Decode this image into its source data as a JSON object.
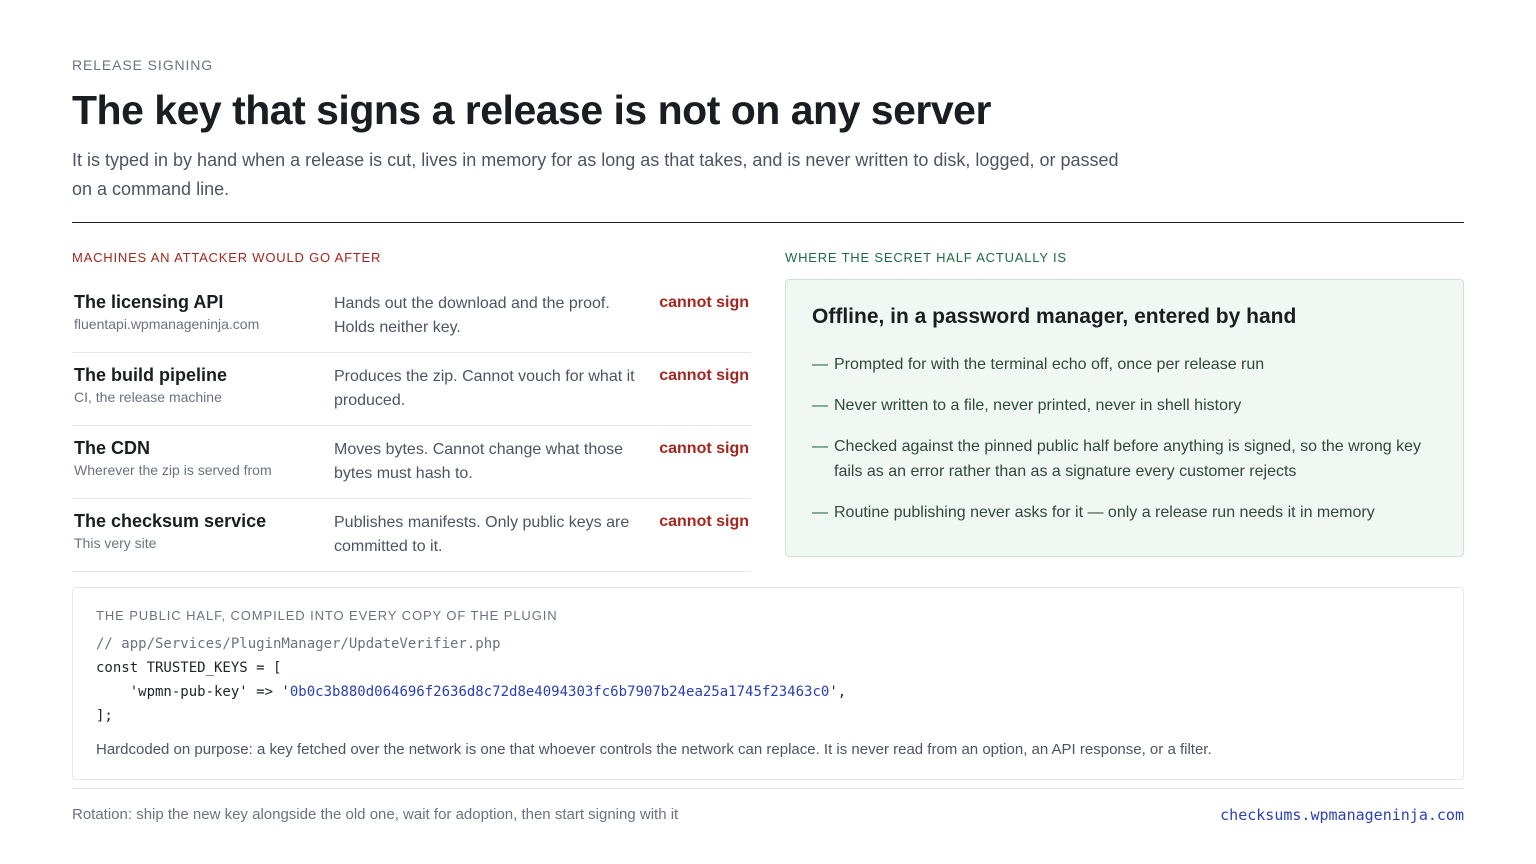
{
  "header": {
    "eyebrow": "RELEASE SIGNING",
    "title": "The key that signs a release is not on any server",
    "subtitle": "It is typed in by hand when a release is cut, lives in memory for as long as that takes, and is never written to disk, logged, or passed on a command line."
  },
  "left_section": {
    "label": "MACHINES AN ATTACKER WOULD GO AFTER",
    "machines": [
      {
        "name": "The licensing API",
        "sub": "fluentapi.wpmanageninja.com",
        "desc": "Hands out the download and the proof. Holds neither key.",
        "verdict": "cannot sign"
      },
      {
        "name": "The build pipeline",
        "sub": "CI, the release machine",
        "desc": "Produces the zip. Cannot vouch for what it produced.",
        "verdict": "cannot sign"
      },
      {
        "name": "The CDN",
        "sub": "Wherever the zip is served from",
        "desc": "Moves bytes. Cannot change what those bytes must hash to.",
        "verdict": "cannot sign"
      },
      {
        "name": "The checksum service",
        "sub": "This very site",
        "desc": "Publishes manifests. Only public keys are committed to it.",
        "verdict": "cannot sign"
      }
    ]
  },
  "right_section": {
    "label": "WHERE THE SECRET HALF ACTUALLY IS",
    "heading": "Offline, in a password manager, entered by hand",
    "dash": "—",
    "points": [
      "Prompted for with the terminal echo off, once per release run",
      "Never written to a file, never printed, never in shell history",
      "Checked against the pinned public half before anything is signed, so the wrong key fails as an error rather than as a signature every customer rejects",
      "Routine publishing never asks for it — only a release run needs it in memory"
    ]
  },
  "code_block": {
    "label": "THE PUBLIC HALF, COMPILED INTO EVERY COPY OF THE PLUGIN",
    "comment": "// app/Services/PluginManager/UpdateVerifier.php",
    "line_open": "const TRUSTED_KEYS = [",
    "key_prefix": "    'wpmn-pub-key' => '",
    "key_hash": "0b0c3b880d064696f2636d8c72d8e4094303fc6b7907b24ea25a1745f23463c0",
    "key_suffix": "',",
    "line_close": "];",
    "note": "Hardcoded on purpose: a key fetched over the network is one that whoever controls the network can replace. It is never read from an option, an API response, or a filter."
  },
  "footer": {
    "left": "Rotation: ship the new key alongside the old one, wait for adoption, then start signing with it",
    "right": "checksums.wpmanageninja.com"
  }
}
